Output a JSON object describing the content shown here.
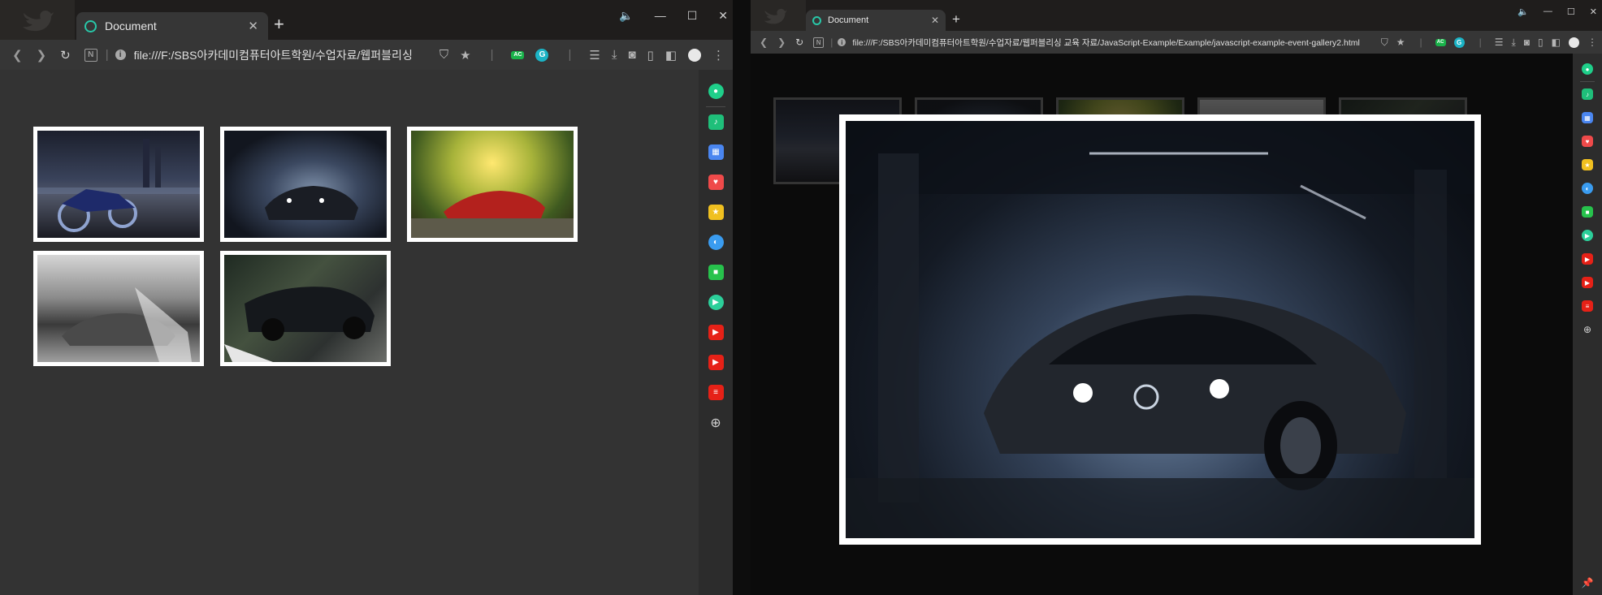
{
  "left_window": {
    "tab_title": "Document",
    "url": "file:///F:/SBS아카데미컴퓨터아트학원/수업자료/웹퍼블리싱",
    "nav_page_icon_letter": "N"
  },
  "right_window": {
    "tab_title": "Document",
    "url": "file:///F:/SBS아카데미컴퓨터아트학원/수업자료/웹퍼블리싱 교육 자료/JavaScript-Example/Example/javascript-example-event-gallery2.html",
    "nav_page_icon_letter": "N"
  },
  "extensions": {
    "ac_label": "AC",
    "g_label": "G"
  },
  "sidebar_icons": [
    {
      "name": "whale-icon",
      "color": "#1fcf8a"
    },
    {
      "name": "bell-icon",
      "color": "#1fbf7a"
    },
    {
      "name": "calendar-icon",
      "color": "#4a86f0"
    },
    {
      "name": "pocket-icon",
      "color": "#ef4a4a"
    },
    {
      "name": "star-icon",
      "color": "#f0c020"
    },
    {
      "name": "translate-icon",
      "color": "#3a9cf0"
    },
    {
      "name": "green-app-icon",
      "color": "#27c24c"
    },
    {
      "name": "play-icon",
      "color": "#2ccf9a"
    },
    {
      "name": "youtube-icon",
      "color": "#e62117"
    },
    {
      "name": "youtube-alt-icon",
      "color": "#e62117"
    },
    {
      "name": "papago-icon",
      "color": "#e62117"
    }
  ],
  "gallery_images": [
    {
      "name": "motorbike-photo",
      "style": "bike"
    },
    {
      "name": "garage-car-photo",
      "style": "garage"
    },
    {
      "name": "red-sports-car-photo",
      "style": "forest"
    },
    {
      "name": "lamborghini-photo",
      "style": "storm"
    },
    {
      "name": "bugatti-photo",
      "style": "road"
    }
  ],
  "colors": {
    "accent": "#28c7a8",
    "page_bg": "#333333",
    "overlay_bg": "#0b0b0b",
    "frame": "#ffffff"
  }
}
